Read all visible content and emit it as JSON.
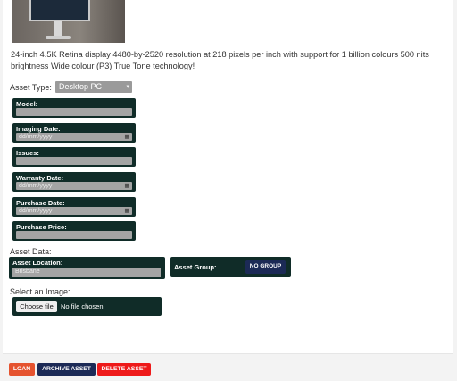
{
  "description": "24-inch 4.5K Retina display 4480-by-2520 resolution at 218 pixels per inch with support for 1 billion colours 500 nits brightness Wide colour (P3) True Tone technology!",
  "asset_type": {
    "label": "Asset Type:",
    "value": "Desktop PC"
  },
  "fields": {
    "model": {
      "label": "Model:",
      "value": ""
    },
    "imaging_date": {
      "label": "Imaging Date:",
      "placeholder": "dd/mm/yyyy"
    },
    "issues": {
      "label": "Issues:",
      "value": ""
    },
    "warranty_date": {
      "label": "Warranty Date:",
      "placeholder": "dd/mm/yyyy"
    },
    "purchase_date": {
      "label": "Purchase Date:",
      "placeholder": "dd/mm/yyyy"
    },
    "purchase_price": {
      "label": "Purchase Price:",
      "value": ""
    }
  },
  "asset_data": {
    "heading": "Asset Data:",
    "location": {
      "label": "Asset Location:",
      "value": "Brisbane"
    },
    "group": {
      "label": "Asset Group:",
      "button": "NO GROUP"
    }
  },
  "image": {
    "label": "Select an Image:",
    "button": "Choose file",
    "status": "No file chosen"
  },
  "actions": {
    "loan": "LOAN",
    "archive": "ARCHIVE ASSET",
    "delete": "DELETE ASSET"
  },
  "colors": {
    "field_bg": "#102c28",
    "navy": "#1c2a56",
    "loan": "#e5532f",
    "delete": "#ee1a1a"
  },
  "icons": {
    "calendar": "calendar-icon",
    "caret": "chevron-down-icon"
  }
}
